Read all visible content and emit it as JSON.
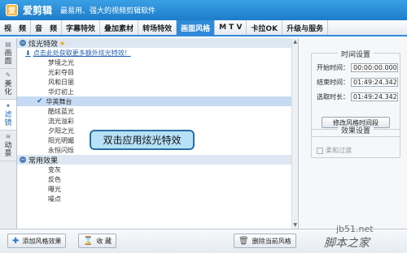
{
  "titlebar": {
    "app_name": "爱剪辑",
    "slogan": "最易用、强大的视频剪辑软件",
    "logo_char": "爱"
  },
  "tabs": [
    "视　频",
    "音　频",
    "字幕特效",
    "叠加素材",
    "转场特效",
    "画面风格",
    "M T V",
    "卡拉OK",
    "升级与服务"
  ],
  "active_tab": "画面风格",
  "side_tabs": [
    {
      "label": "画\n面",
      "icon": "picture-icon"
    },
    {
      "label": "美\n化",
      "icon": "wand-icon"
    },
    {
      "label": "滤\n镜",
      "icon": "filter-icon"
    },
    {
      "label": "动\n景",
      "icon": "motion-icon"
    }
  ],
  "list": {
    "cat1": {
      "toggle": "−",
      "label": "炫光特效"
    },
    "get_more": "点击此处获取更多额外炫光特效！",
    "items1": [
      "梦境之光",
      "光彩夺目",
      "风和日丽",
      "华灯初上",
      "华美舞台",
      "酷炫蓝光",
      "流光溢彩",
      "夕阳之光",
      "阳光明媚",
      "永恒闪烁"
    ],
    "selected": "华美舞台",
    "cat2": {
      "toggle": "−",
      "label": "常用效果"
    },
    "items2": [
      "变灰",
      "反色",
      "曝光",
      "噪点"
    ]
  },
  "tooltip": "双击应用炫光特效",
  "time_settings": {
    "title": "时间设置",
    "start_label": "开始时间：",
    "start_value": "00:00:00.000",
    "end_label": "结束时间：",
    "end_value": "01:49:24.342",
    "duration_label": "选取时长：",
    "duration_value": "01:49:24.342",
    "modify_button": "修改风格时间段"
  },
  "effect_settings": {
    "title": "效果设置",
    "soft_transition": "柔和过渡"
  },
  "bottom": {
    "add": "添加风格效果",
    "favorite": "收 藏",
    "delete": "删除当前风格"
  },
  "watermark": {
    "line1": "jb51.net",
    "line2": "脚本之家"
  },
  "colors": {
    "accent": "#2f8ad9",
    "title_bar": "#1e7cc8",
    "selection": "#c6dbf3",
    "link": "#1f5fb0"
  }
}
